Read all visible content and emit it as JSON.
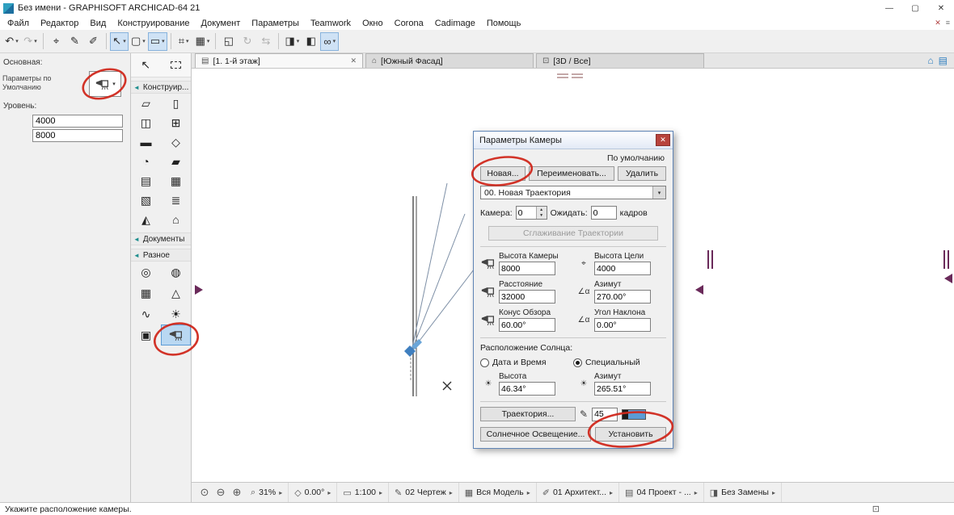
{
  "titlebar": {
    "title": "Без имени - GRAPHISOFT ARCHICAD-64 21",
    "controls": {
      "minimize": "—",
      "maximize": "▢",
      "close": "✕"
    }
  },
  "menubar": {
    "items": [
      "Файл",
      "Редактор",
      "Вид",
      "Конструирование",
      "Документ",
      "Параметры",
      "Teamwork",
      "Окно",
      "Corona",
      "Cadimage",
      "Помощь"
    ]
  },
  "toolbar": {
    "items": [
      {
        "name": "undo",
        "glyph": "↶"
      },
      {
        "name": "redo",
        "glyph": "↷"
      },
      {
        "name": "find-select",
        "glyph": "⌖"
      },
      {
        "name": "pick-up-parameters",
        "glyph": "✎"
      },
      {
        "name": "inject-parameters",
        "glyph": "✐"
      },
      {
        "name": "arrow-tool",
        "glyph": "↖"
      },
      {
        "name": "marquee-tool",
        "glyph": "▢"
      },
      {
        "name": "wall-shortcut",
        "glyph": "▭"
      },
      {
        "name": "snap-grid",
        "glyph": "⌗"
      },
      {
        "name": "guide-lines",
        "glyph": "▦"
      },
      {
        "name": "groups",
        "glyph": "◱"
      },
      {
        "name": "rotate",
        "glyph": "↻"
      },
      {
        "name": "mirror",
        "glyph": "⇆"
      },
      {
        "name": "trace-reference",
        "glyph": "◨"
      },
      {
        "name": "cutaway-3d",
        "glyph": "◧"
      },
      {
        "name": "glasses-3d",
        "glyph": "∞"
      }
    ]
  },
  "tabbar": {
    "tabs": [
      {
        "icon": "▤",
        "label": "[1. 1-й этаж]"
      },
      {
        "icon": "⌂",
        "label": "[Южный Фасад]"
      },
      {
        "icon": "⊡",
        "label": "[3D / Все]"
      }
    ],
    "extras": [
      {
        "glyph": "⌂"
      },
      {
        "glyph": "▤"
      }
    ]
  },
  "info_panel": {
    "section": "Основная:",
    "defaults": "Параметры по Умолчанию",
    "level": "Уровень:",
    "upper": "4000",
    "lower": "8000"
  },
  "toolbox": {
    "headers": [
      "Конструир...",
      "Документы",
      "Разное"
    ],
    "construct_tools": [
      {
        "name": "wall-tool",
        "glyph": "▱"
      },
      {
        "name": "column-tool",
        "glyph": "▯"
      },
      {
        "name": "door-tool",
        "glyph": "◫"
      },
      {
        "name": "window-tool",
        "glyph": "⊞"
      },
      {
        "name": "beam-tool",
        "glyph": "▬"
      },
      {
        "name": "roof-tool",
        "glyph": "◇"
      },
      {
        "name": "shell-tool",
        "glyph": "◔"
      },
      {
        "name": "slab-tool",
        "glyph": "▰"
      },
      {
        "name": "curtain-wall-tool",
        "glyph": "▤"
      },
      {
        "name": "mesh-tool",
        "glyph": "▦"
      },
      {
        "name": "zone-tool",
        "glyph": "▧"
      },
      {
        "name": "stair-tool",
        "glyph": "≣"
      },
      {
        "name": "morph-tool",
        "glyph": "◭"
      },
      {
        "name": "object-tool",
        "glyph": "⌂"
      }
    ],
    "misc_tools": [
      {
        "name": "hotspot-tool",
        "glyph": "◎"
      },
      {
        "name": "lamp-tool",
        "glyph": "◍"
      },
      {
        "name": "grid-element-tool",
        "glyph": "▦"
      },
      {
        "name": "level-dimension-tool",
        "glyph": "△"
      },
      {
        "name": "spline-tool",
        "glyph": "∿"
      },
      {
        "name": "sun-object-tool",
        "glyph": "☀"
      },
      {
        "name": "figure-tool",
        "glyph": "▣"
      }
    ]
  },
  "dialog": {
    "title": "Параметры Камеры",
    "default_label": "По умолчанию",
    "buttons": {
      "new": "Новая...",
      "rename": "Переименовать...",
      "delete": "Удалить"
    },
    "path_value": "00. Новая Траектория",
    "camera_label": "Камера:",
    "camera_value": "0",
    "wait_label": "Ожидать:",
    "wait_value": "0",
    "frames_label": "кадров",
    "smooth_label": "Сглаживание Траектории",
    "params": [
      {
        "name": "camera-height",
        "label": "Высота Камеры",
        "value": "8000"
      },
      {
        "name": "target-height",
        "label": "Высота Цели",
        "value": "4000"
      },
      {
        "name": "distance",
        "label": "Расстояние",
        "value": "32000"
      },
      {
        "name": "azimuth",
        "label": "Азимут",
        "value": "270.00°"
      },
      {
        "name": "view-cone",
        "label": "Конус Обзора",
        "value": "60.00°"
      },
      {
        "name": "tilt-angle",
        "label": "Угол Наклона",
        "value": "0.00°"
      }
    ],
    "sun_section_label": "Расположение Солнца:",
    "radio_datetime": "Дата и Время",
    "radio_special": "Специальный",
    "sun_params": [
      {
        "name": "sun-altitude",
        "label": "Высота",
        "value": "46.34°"
      },
      {
        "name": "sun-azimuth",
        "label": "Азимут",
        "value": "265.51°"
      }
    ],
    "path_button": "Траектория...",
    "pen_value": "45",
    "sun_button": "Солнечное Освещение...",
    "apply_button": "Установить"
  },
  "statusbar": {
    "zoom_buttons": [
      {
        "name": "zoom-reset",
        "glyph": "⊙"
      },
      {
        "name": "zoom-out",
        "glyph": "⊖"
      },
      {
        "name": "zoom-in",
        "glyph": "⊕"
      }
    ],
    "items": [
      {
        "name": "zoom-level",
        "icon": "⌕",
        "label": "31%"
      },
      {
        "name": "orientation",
        "icon": "◇",
        "label": "0.00°"
      },
      {
        "name": "scale",
        "icon": "▭",
        "label": "1:100"
      },
      {
        "name": "pen-set",
        "icon": "✎",
        "label": "02 Чертеж"
      },
      {
        "name": "layer-combination",
        "icon": "▦",
        "label": "Вся Модель"
      },
      {
        "name": "dimension-style",
        "icon": "✐",
        "label": "01 Архитект..."
      },
      {
        "name": "layout-book",
        "icon": "▤",
        "label": "04 Проект - ..."
      },
      {
        "name": "graphic-override",
        "icon": "◨",
        "label": "Без Замены"
      }
    ]
  },
  "hintbar": {
    "message": "Укажите расположение камеры."
  },
  "icons": {
    "dropdown": "▾",
    "chevron": "▸",
    "close": "✕",
    "menu": "≡",
    "section_arrow": "◄",
    "spin_up": "▲",
    "spin_down": "▼",
    "angle": "∠α",
    "target": "⌖",
    "sun": "☀",
    "pen": "✎",
    "layout": "⊡"
  },
  "colors": {
    "annotation": "#d0281c",
    "selection": "#3f7fbf"
  }
}
